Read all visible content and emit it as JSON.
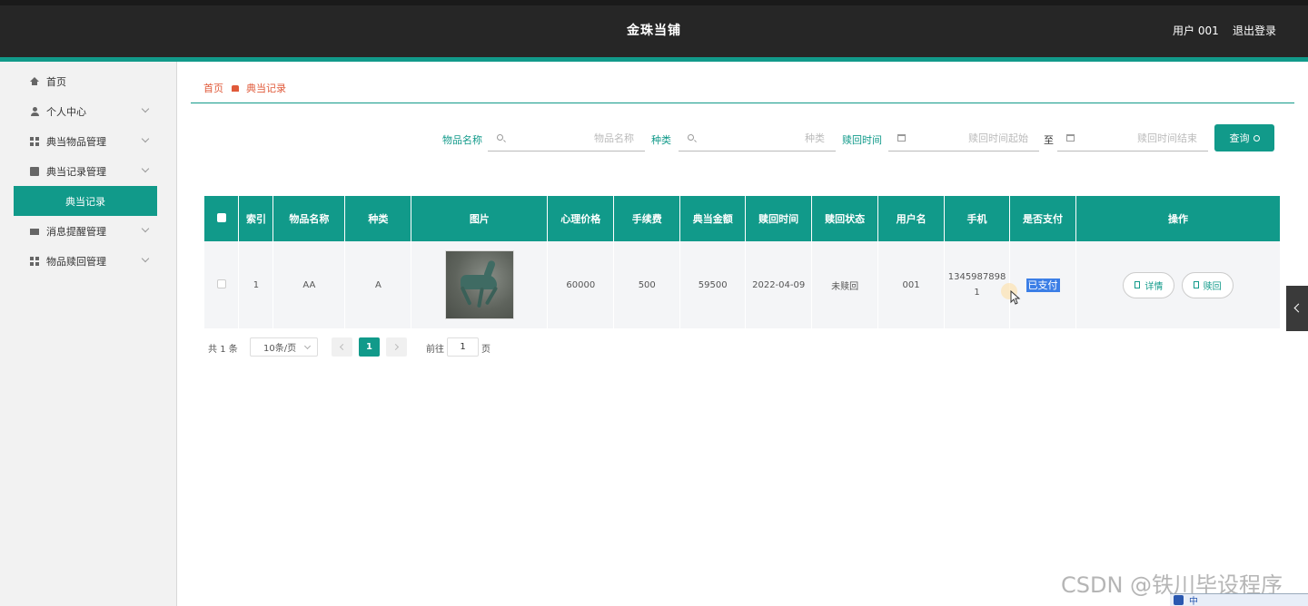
{
  "header": {
    "title": "金珠当铺",
    "user": "用户 001",
    "logout": "退出登录"
  },
  "sidebar": {
    "items": [
      {
        "label": "首页",
        "icon": "home-icon"
      },
      {
        "label": "个人中心",
        "icon": "user-icon"
      },
      {
        "label": "典当物品管理",
        "icon": "grid-icon"
      },
      {
        "label": "典当记录管理",
        "icon": "document-icon"
      },
      {
        "label": "消息提醒管理",
        "icon": "message-icon"
      },
      {
        "label": "物品赎回管理",
        "icon": "grid-icon"
      }
    ],
    "active_sub": "典当记录"
  },
  "breadcrumb": {
    "home": "首页",
    "current": "典当记录"
  },
  "search": {
    "name_label": "物品名称",
    "name_placeholder": "物品名称",
    "type_label": "种类",
    "type_placeholder": "种类",
    "time_label": "赎回时间",
    "start_placeholder": "赎回时间起始",
    "to": "至",
    "end_placeholder": "赎回时间结束",
    "query": "查询"
  },
  "table": {
    "headers": [
      "索引",
      "物品名称",
      "种类",
      "图片",
      "心理价格",
      "手续费",
      "典当金额",
      "赎回时间",
      "赎回状态",
      "用户名",
      "手机",
      "是否支付",
      "操作"
    ],
    "rows": [
      {
        "index": "1",
        "name": "AA",
        "type": "A",
        "price": "60000",
        "fee": "500",
        "amount": "59500",
        "redeem_time": "2022-04-09",
        "redeem_status": "未赎回",
        "username": "001",
        "phone_line1": "1345987898",
        "phone_line2": "1",
        "paid": "已支付",
        "detail": "详情",
        "redeem": "赎回"
      }
    ]
  },
  "pagination": {
    "total_prefix": "共",
    "total": "1",
    "total_suffix": "条",
    "page_size": "10条/页",
    "current_page": "1",
    "goto": "前往",
    "goto_value": "1",
    "page_unit": "页"
  },
  "watermark": "CSDN @铁川毕设程序",
  "ime": "中"
}
